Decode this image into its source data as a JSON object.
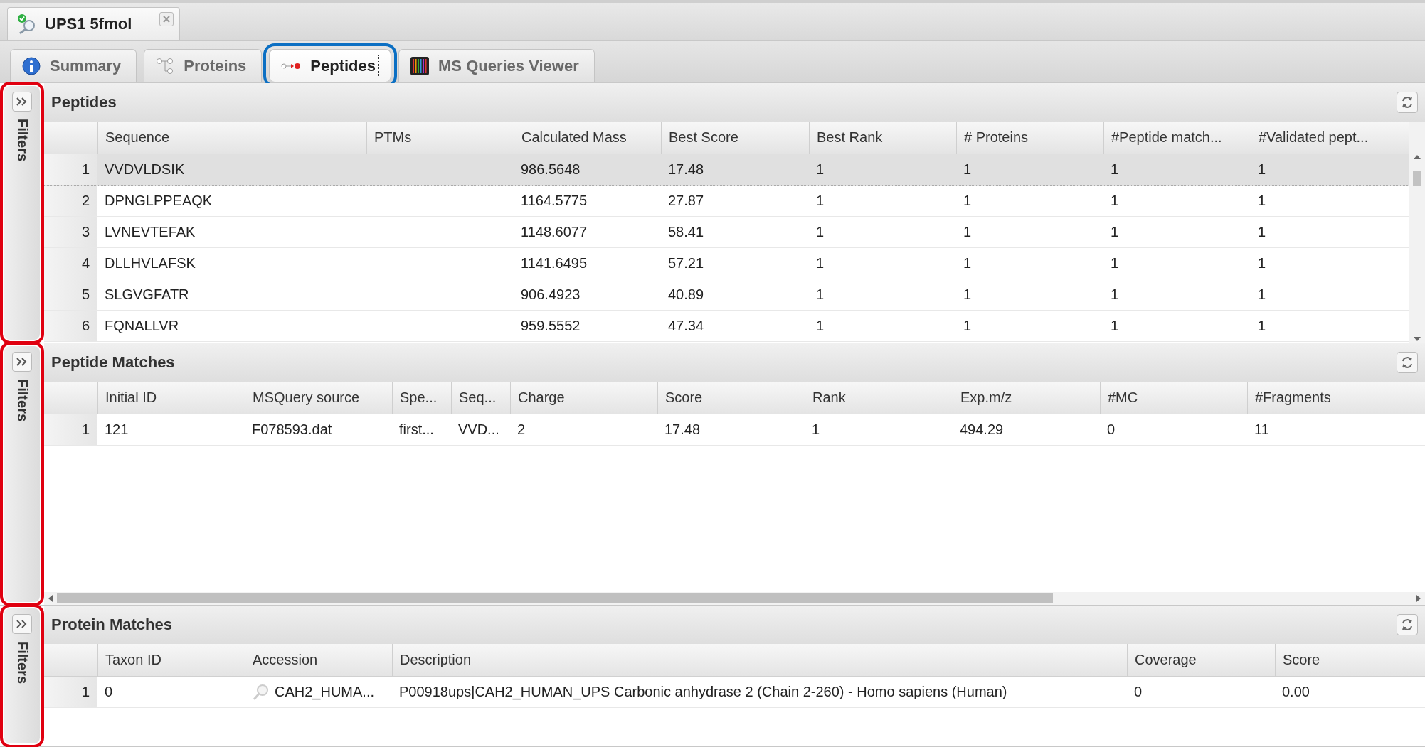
{
  "document_tab": {
    "title": "UPS1 5fmol"
  },
  "tabs": [
    {
      "label": "Summary",
      "selected": false,
      "highlighted": false
    },
    {
      "label": "Proteins",
      "selected": false,
      "highlighted": false
    },
    {
      "label": "Peptides",
      "selected": true,
      "highlighted": true
    },
    {
      "label": "MS Queries Viewer",
      "selected": false,
      "highlighted": false
    }
  ],
  "panels": [
    {
      "title": "Peptides",
      "filters_label": "Filters",
      "filters_highlighted": true,
      "vertical_scrollbar": true,
      "columns": [
        {
          "label": "Sequence"
        },
        {
          "label": "PTMs"
        },
        {
          "label": "Calculated Mass"
        },
        {
          "label": "Best Score"
        },
        {
          "label": "Best Rank"
        },
        {
          "label": "# Proteins"
        },
        {
          "label": "#Peptide match..."
        },
        {
          "label": "#Validated pept..."
        }
      ],
      "rows": [
        {
          "number": "1",
          "selected": true,
          "cells": [
            "VVDVLDSIK",
            "",
            "986.5648",
            "17.48",
            "1",
            "1",
            "1",
            "1"
          ]
        },
        {
          "number": "2",
          "selected": false,
          "cells": [
            "DPNGLPPEAQK",
            "",
            "1164.5775",
            "27.87",
            "1",
            "1",
            "1",
            "1"
          ]
        },
        {
          "number": "3",
          "selected": false,
          "cells": [
            "LVNEVTEFAK",
            "",
            "1148.6077",
            "58.41",
            "1",
            "1",
            "1",
            "1"
          ]
        },
        {
          "number": "4",
          "selected": false,
          "cells": [
            "DLLHVLAFSK",
            "",
            "1141.6495",
            "57.21",
            "1",
            "1",
            "1",
            "1"
          ]
        },
        {
          "number": "5",
          "selected": false,
          "cells": [
            "SLGVGFATR",
            "",
            "906.4923",
            "40.89",
            "1",
            "1",
            "1",
            "1"
          ]
        },
        {
          "number": "6",
          "selected": false,
          "cells": [
            "FQNALLVR",
            "",
            "959.5552",
            "47.34",
            "1",
            "1",
            "1",
            "1"
          ]
        }
      ]
    },
    {
      "title": "Peptide Matches",
      "filters_label": "Filters",
      "filters_highlighted": true,
      "horizontal_scrollbar": true,
      "columns": [
        {
          "label": "Initial ID"
        },
        {
          "label": "MSQuery source"
        },
        {
          "label": "Spe..."
        },
        {
          "label": "Seq..."
        },
        {
          "label": "Charge"
        },
        {
          "label": "Score"
        },
        {
          "label": "Rank"
        },
        {
          "label": "Exp.m/z"
        },
        {
          "label": "#MC"
        },
        {
          "label": "#Fragments"
        }
      ],
      "rows": [
        {
          "number": "1",
          "selected": false,
          "cells": [
            "121",
            "F078593.dat",
            "first...",
            "VVD...",
            "2",
            "17.48",
            "1",
            "494.29",
            "0",
            "11"
          ]
        }
      ]
    },
    {
      "title": "Protein Matches",
      "filters_label": "Filters",
      "filters_highlighted": true,
      "columns": [
        {
          "label": "Taxon ID"
        },
        {
          "label": "Accession",
          "kind": "search-link"
        },
        {
          "label": "Description"
        },
        {
          "label": "Coverage"
        },
        {
          "label": "Score"
        }
      ],
      "rows": [
        {
          "number": "1",
          "selected": false,
          "cells": [
            "0",
            "CAH2_HUMA...",
            "P00918ups|CAH2_HUMAN_UPS Carbonic anhydrase 2 (Chain 2-260) - Homo sapiens (Human)",
            "0",
            "0.00"
          ]
        }
      ]
    }
  ]
}
